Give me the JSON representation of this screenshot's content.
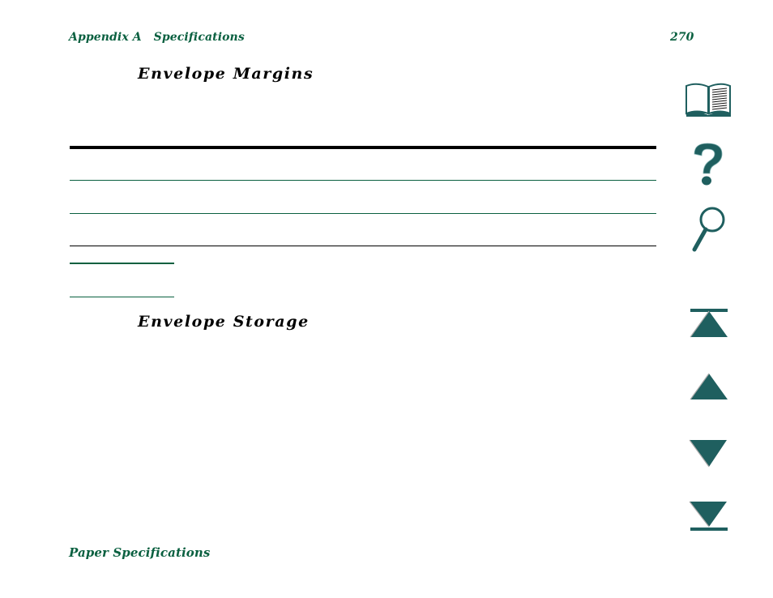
{
  "header": {
    "section": "Appendix A   Specifications",
    "page_number": "270"
  },
  "sections": [
    {
      "title": "Envelope Margins"
    },
    {
      "title": "Envelope Storage"
    }
  ],
  "footer": {
    "chapter_link": "Paper Specifications"
  },
  "nav": {
    "items": [
      {
        "name": "contents",
        "icon": "book-icon"
      },
      {
        "name": "help",
        "icon": "question-mark-icon"
      },
      {
        "name": "search",
        "icon": "magnifier-icon"
      },
      {
        "name": "first-page",
        "icon": "first-page-icon"
      },
      {
        "name": "previous-page",
        "icon": "up-triangle-icon"
      },
      {
        "name": "next-page",
        "icon": "down-triangle-icon"
      },
      {
        "name": "last-page",
        "icon": "last-page-icon"
      }
    ]
  },
  "colors": {
    "accent_green": "#0a6040",
    "icon_teal": "#1f5f5f",
    "text": "#000000"
  }
}
